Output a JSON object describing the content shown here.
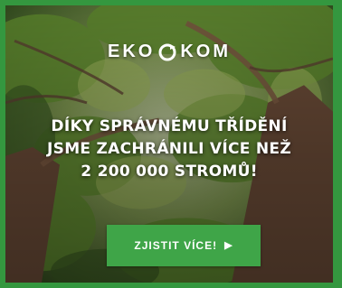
{
  "brand": {
    "logo_text_left": "EKO",
    "logo_text_right": "KOM",
    "logo_mark_icon": "recycle-circle-icon"
  },
  "headline": {
    "line1": "DÍKY SPRÁVNÉMU TŘÍDĚNÍ",
    "line2": "JSME ZACHRÁNILI VÍCE NEŽ",
    "line3": "2 200 000 STROMŮ!"
  },
  "cta": {
    "label": "ZJISTIT VÍCE!",
    "icon": "chevron-right-icon"
  },
  "colors": {
    "accent": "#3fa548",
    "frame": "#34973f",
    "text": "#ffffff"
  }
}
